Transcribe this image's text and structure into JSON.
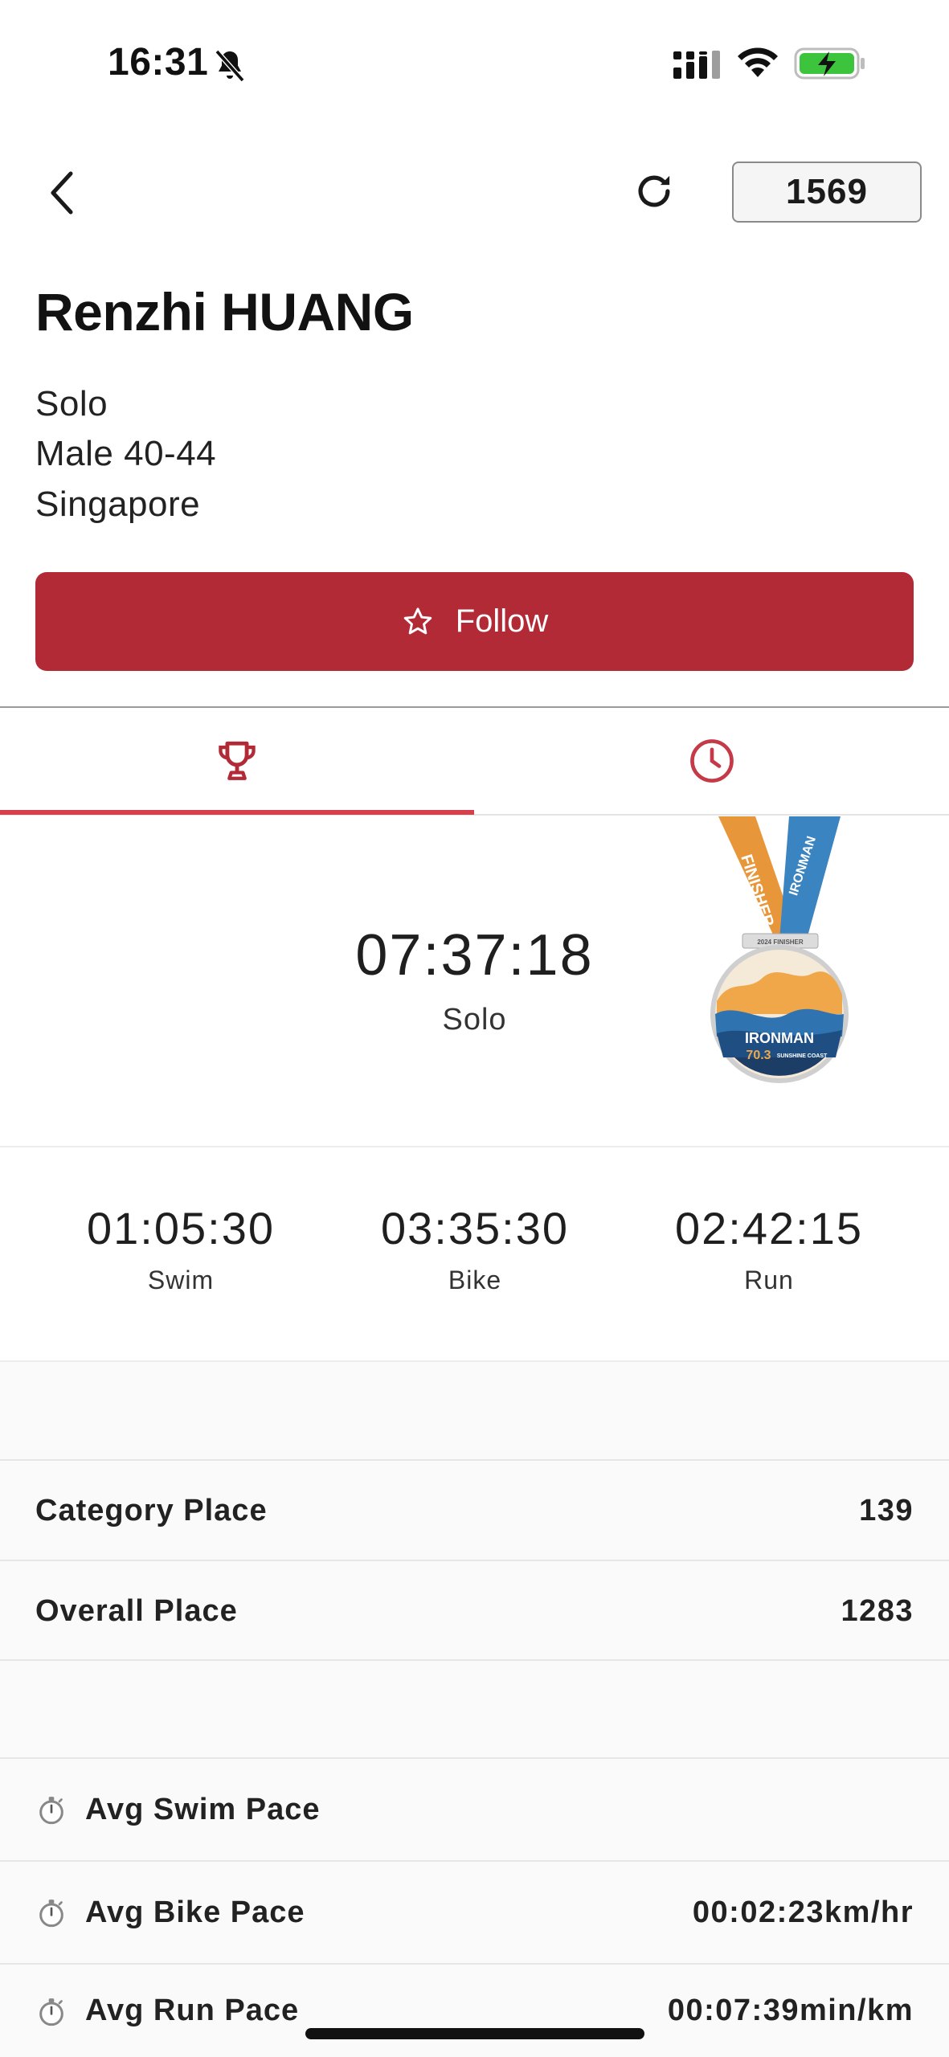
{
  "status_bar": {
    "time": "16:31",
    "icons": [
      "bell-off-icon",
      "signal-icon",
      "wifi-icon",
      "battery-charging-icon"
    ],
    "battery_color": "#3cc53c"
  },
  "header": {
    "back_icon": "chevron-left-icon",
    "refresh_icon": "refresh-icon",
    "bib_number": "1569"
  },
  "athlete": {
    "name": "Renzhi HUANG",
    "division": "Solo",
    "category": "Male 40-44",
    "country": "Singapore"
  },
  "follow_button": {
    "label": "Follow",
    "icon": "star-outline-icon",
    "color": "#b32a37"
  },
  "tabs": [
    {
      "icon": "trophy-icon",
      "active": true
    },
    {
      "icon": "clock-icon",
      "active": false
    }
  ],
  "accent_color": "#d4414c",
  "finish": {
    "time": "07:37:18",
    "label": "Solo",
    "medal_texts": [
      "FINISHER",
      "2024 FINISHER",
      "IRONMAN",
      "70.3",
      "SUNSHINE COAST"
    ]
  },
  "splits": [
    {
      "time": "01:05:30",
      "label": "Swim"
    },
    {
      "time": "03:35:30",
      "label": "Bike"
    },
    {
      "time": "02:42:15",
      "label": "Run"
    }
  ],
  "places": [
    {
      "label": "Category Place",
      "value": "139"
    },
    {
      "label": "Overall Place",
      "value": "1283"
    }
  ],
  "paces": [
    {
      "label": "Avg Swim Pace",
      "value": "",
      "icon": "stopwatch-icon"
    },
    {
      "label": "Avg Bike Pace",
      "value": "00:02:23km/hr",
      "icon": "stopwatch-icon"
    },
    {
      "label": "Avg Run Pace",
      "value": "00:07:39min/km",
      "icon": "stopwatch-icon"
    }
  ]
}
